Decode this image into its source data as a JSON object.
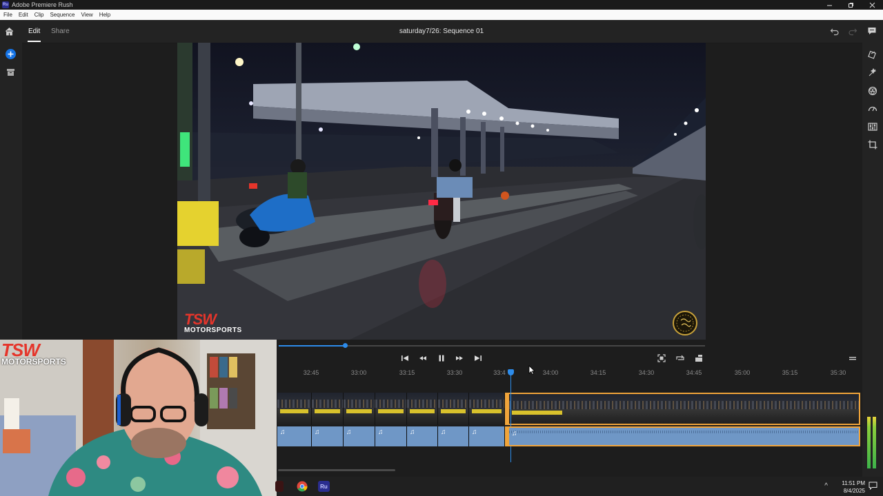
{
  "window": {
    "app_badge": "Ru",
    "title": "Adobe Premiere Rush",
    "controls": [
      "minimize",
      "restore",
      "close"
    ]
  },
  "menu": [
    "File",
    "Edit",
    "Clip",
    "Sequence",
    "View",
    "Help"
  ],
  "header": {
    "tabs": [
      {
        "label": "Edit",
        "active": true
      },
      {
        "label": "Share",
        "active": false
      }
    ],
    "sequence_title": "saturday7/26: Sequence 01"
  },
  "icons": {
    "header": [
      "home-icon",
      "undo-icon",
      "redo-icon",
      "comment-icon"
    ],
    "left_rail": [
      "add-media-icon",
      "project-assets-icon"
    ],
    "right_rail": [
      "transitions-icon",
      "effects-icon",
      "color-icon",
      "speed-icon",
      "audio-icon",
      "crop-icon"
    ],
    "transport": [
      "go-to-start-icon",
      "step-back-icon",
      "pause-icon",
      "step-forward-icon",
      "go-to-end-icon"
    ],
    "view_controls": [
      "fullscreen-icon",
      "loop-icon",
      "layout-icon",
      "panel-menu-icon"
    ]
  },
  "preview": {
    "watermark_left_line1": "TSW",
    "watermark_left_line2": "MOTORSPORTS",
    "playhead_fraction": 0.155
  },
  "timeline": {
    "ruler": [
      "32:45",
      "33:00",
      "33:15",
      "33:30",
      "33:4",
      "34:00",
      "34:15",
      "34:30",
      "34:45",
      "35:00",
      "35:15",
      "35:30"
    ],
    "audio_clip_glyph": "♫"
  },
  "webcam": {
    "overlay_line1": "TSW",
    "overlay_line2": "MOTORSPORTS"
  },
  "taskbar": {
    "pinned": [
      "chrome",
      "premiere-rush"
    ],
    "rush_label": "Ru",
    "time": "11:51 PM",
    "date": "8/4/2025",
    "tray_chevron": "^"
  },
  "colors": {
    "accent": "#2d8ceb",
    "selection": "#f0a43a",
    "audio": "#6f97c6",
    "brand_red": "#e5352b"
  }
}
